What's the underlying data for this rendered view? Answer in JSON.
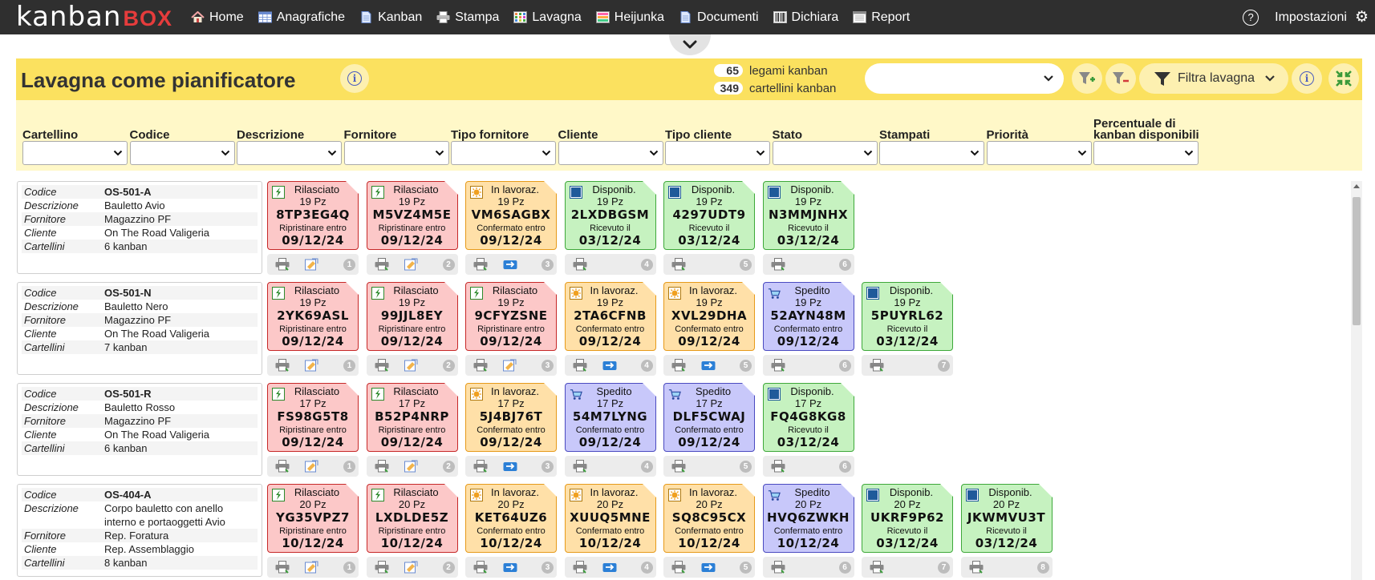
{
  "logo": {
    "part1": "kanban",
    "part2": "BOX"
  },
  "nav": {
    "items": [
      {
        "label": "Home",
        "icon": "home-icon"
      },
      {
        "label": "Anagrafiche",
        "icon": "table-icon"
      },
      {
        "label": "Kanban",
        "icon": "document-icon"
      },
      {
        "label": "Stampa",
        "icon": "printer-icon"
      },
      {
        "label": "Lavagna",
        "icon": "board-icon"
      },
      {
        "label": "Heijunka",
        "icon": "heijunka-icon"
      },
      {
        "label": "Documenti",
        "icon": "documents-icon"
      },
      {
        "label": "Dichiara",
        "icon": "barcode-icon"
      },
      {
        "label": "Report",
        "icon": "report-icon"
      }
    ],
    "help_icon": "?",
    "settings_label": "Impostazioni"
  },
  "header": {
    "title": "Lavagna come pianificatore",
    "legami_count": "65",
    "legami_label": "legami kanban",
    "cartellini_count": "349",
    "cartellini_label": "cartellini kanban",
    "board_select_value": "",
    "filtra_label": "Filtra lavagna"
  },
  "filters": [
    {
      "label": "Cartellino",
      "value": ""
    },
    {
      "label": "Codice",
      "value": ""
    },
    {
      "label": "Descrizione",
      "value": ""
    },
    {
      "label": "Fornitore",
      "value": ""
    },
    {
      "label": "Tipo fornitore",
      "value": ""
    },
    {
      "label": "Cliente",
      "value": ""
    },
    {
      "label": "Tipo cliente",
      "value": ""
    },
    {
      "label": "Stato",
      "value": ""
    },
    {
      "label": "Stampati",
      "value": ""
    },
    {
      "label": "Priorità",
      "value": ""
    },
    {
      "label": "Percentuale di kanban disponibili",
      "value": ""
    }
  ],
  "colors": {
    "red": "#fcc8c8",
    "orange": "#ffe0a8",
    "blue": "#c8c8fa",
    "green": "#c6f2c0",
    "header": "#fbe15f"
  },
  "items": [
    {
      "info": [
        [
          "Codice",
          "OS-501-A"
        ],
        [
          "Descrizione",
          "Bauletto Avio"
        ],
        [
          "Fornitore",
          "Magazzino PF"
        ],
        [
          "Cliente",
          "On The Road Valigeria"
        ],
        [
          "Cartellini",
          "6 kanban"
        ]
      ],
      "cards": [
        {
          "stato": "Rilasciato",
          "qty": "19 Pz",
          "code": "8TP3EG4Q",
          "note": "Ripristinare entro",
          "date": "09/12/24",
          "color": "red",
          "num": "1"
        },
        {
          "stato": "Rilasciato",
          "qty": "19 Pz",
          "code": "M5VZ4M5E",
          "note": "Ripristinare entro",
          "date": "09/12/24",
          "color": "red",
          "num": "2"
        },
        {
          "stato": "In lavoraz.",
          "qty": "19 Pz",
          "code": "VM6SAGBX",
          "note": "Confermato entro",
          "date": "09/12/24",
          "color": "orange",
          "num": "3"
        },
        {
          "stato": "Disponib.",
          "qty": "19 Pz",
          "code": "2LXDBGSM",
          "note": "Ricevuto il",
          "date": "03/12/24",
          "color": "green",
          "num": "4"
        },
        {
          "stato": "Disponib.",
          "qty": "19 Pz",
          "code": "4297UDT9",
          "note": "Ricevuto il",
          "date": "03/12/24",
          "color": "green",
          "num": "5"
        },
        {
          "stato": "Disponib.",
          "qty": "19 Pz",
          "code": "N3MMJNHX",
          "note": "Ricevuto il",
          "date": "03/12/24",
          "color": "green",
          "num": "6"
        }
      ]
    },
    {
      "info": [
        [
          "Codice",
          "OS-501-N"
        ],
        [
          "Descrizione",
          "Bauletto Nero"
        ],
        [
          "Fornitore",
          "Magazzino PF"
        ],
        [
          "Cliente",
          "On The Road Valigeria"
        ],
        [
          "Cartellini",
          "7 kanban"
        ]
      ],
      "cards": [
        {
          "stato": "Rilasciato",
          "qty": "19 Pz",
          "code": "2YK69ASL",
          "note": "Ripristinare entro",
          "date": "09/12/24",
          "color": "red",
          "num": "1"
        },
        {
          "stato": "Rilasciato",
          "qty": "19 Pz",
          "code": "99JJL8EY",
          "note": "Ripristinare entro",
          "date": "09/12/24",
          "color": "red",
          "num": "2"
        },
        {
          "stato": "Rilasciato",
          "qty": "19 Pz",
          "code": "9CFYZSNE",
          "note": "Ripristinare entro",
          "date": "09/12/24",
          "color": "red",
          "num": "3"
        },
        {
          "stato": "In lavoraz.",
          "qty": "19 Pz",
          "code": "2TA6CFNB",
          "note": "Confermato entro",
          "date": "09/12/24",
          "color": "orange",
          "num": "4"
        },
        {
          "stato": "In lavoraz.",
          "qty": "19 Pz",
          "code": "XVL29DHA",
          "note": "Confermato entro",
          "date": "09/12/24",
          "color": "orange",
          "num": "5"
        },
        {
          "stato": "Spedito",
          "qty": "19 Pz",
          "code": "52AYN48M",
          "note": "Confermato entro",
          "date": "09/12/24",
          "color": "blue",
          "num": "6"
        },
        {
          "stato": "Disponib.",
          "qty": "19 Pz",
          "code": "5PUYRL62",
          "note": "Ricevuto il",
          "date": "03/12/24",
          "color": "green",
          "num": "7"
        }
      ]
    },
    {
      "info": [
        [
          "Codice",
          "OS-501-R"
        ],
        [
          "Descrizione",
          "Bauletto Rosso"
        ],
        [
          "Fornitore",
          "Magazzino PF"
        ],
        [
          "Cliente",
          "On The Road Valigeria"
        ],
        [
          "Cartellini",
          "6 kanban"
        ]
      ],
      "cards": [
        {
          "stato": "Rilasciato",
          "qty": "17 Pz",
          "code": "FS98G5T8",
          "note": "Ripristinare entro",
          "date": "09/12/24",
          "color": "red",
          "num": "1"
        },
        {
          "stato": "Rilasciato",
          "qty": "17 Pz",
          "code": "B52P4NRP",
          "note": "Ripristinare entro",
          "date": "09/12/24",
          "color": "red",
          "num": "2"
        },
        {
          "stato": "In lavoraz.",
          "qty": "17 Pz",
          "code": "5J4BJ76T",
          "note": "Confermato entro",
          "date": "09/12/24",
          "color": "orange",
          "num": "3"
        },
        {
          "stato": "Spedito",
          "qty": "17 Pz",
          "code": "54M7LYNG",
          "note": "Confermato entro",
          "date": "09/12/24",
          "color": "blue",
          "num": "4"
        },
        {
          "stato": "Spedito",
          "qty": "17 Pz",
          "code": "DLF5CWAJ",
          "note": "Confermato entro",
          "date": "09/12/24",
          "color": "blue",
          "num": "5"
        },
        {
          "stato": "Disponib.",
          "qty": "17 Pz",
          "code": "FQ4G8KG8",
          "note": "Ricevuto il",
          "date": "03/12/24",
          "color": "green",
          "num": "6"
        }
      ]
    },
    {
      "info": [
        [
          "Codice",
          "OS-404-A"
        ],
        [
          "Descrizione",
          "Corpo bauletto con anello interno e portaoggetti Avio"
        ],
        [
          "Fornitore",
          "Rep. Foratura"
        ],
        [
          "Cliente",
          "Rep. Assemblaggio"
        ],
        [
          "Cartellini",
          "8 kanban"
        ]
      ],
      "cards": [
        {
          "stato": "Rilasciato",
          "qty": "20 Pz",
          "code": "YG35VPZ7",
          "note": "Ripristinare entro",
          "date": "10/12/24",
          "color": "red",
          "num": "1"
        },
        {
          "stato": "Rilasciato",
          "qty": "20 Pz",
          "code": "LXDLDE5Z",
          "note": "Ripristinare entro",
          "date": "10/12/24",
          "color": "red",
          "num": "2"
        },
        {
          "stato": "In lavoraz.",
          "qty": "20 Pz",
          "code": "KET64UZ6",
          "note": "Confermato entro",
          "date": "10/12/24",
          "color": "orange",
          "num": "3"
        },
        {
          "stato": "In lavoraz.",
          "qty": "20 Pz",
          "code": "XUUQ5MNE",
          "note": "Confermato entro",
          "date": "10/12/24",
          "color": "orange",
          "num": "4"
        },
        {
          "stato": "In lavoraz.",
          "qty": "20 Pz",
          "code": "SQ8C95CX",
          "note": "Confermato entro",
          "date": "10/12/24",
          "color": "orange",
          "num": "5"
        },
        {
          "stato": "Spedito",
          "qty": "20 Pz",
          "code": "HVQ6ZWKH",
          "note": "Confermato entro",
          "date": "10/12/24",
          "color": "blue",
          "num": "6"
        },
        {
          "stato": "Disponib.",
          "qty": "20 Pz",
          "code": "UKRF9P62",
          "note": "Ricevuto il",
          "date": "03/12/24",
          "color": "green",
          "num": "7"
        },
        {
          "stato": "Disponib.",
          "qty": "20 Pz",
          "code": "JKWMVU3T",
          "note": "Ricevuto il",
          "date": "03/12/24",
          "color": "green",
          "num": "8"
        }
      ]
    }
  ]
}
